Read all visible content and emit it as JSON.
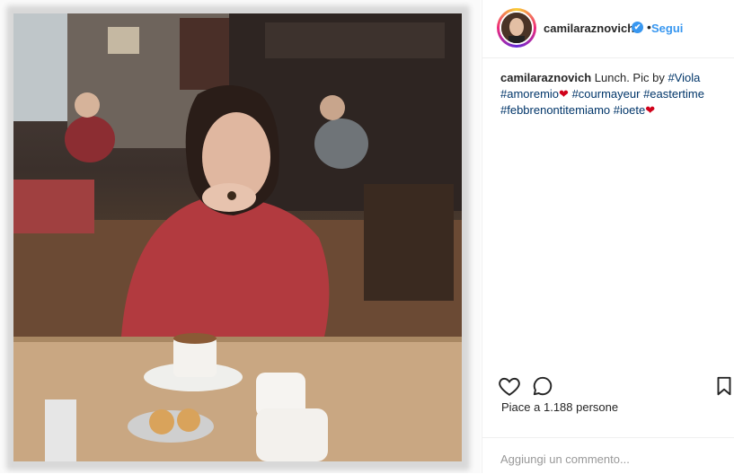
{
  "post": {
    "username": "camilaraznovich",
    "verified_mark": "✔",
    "dot": "•",
    "follow_label": "Segui",
    "caption": {
      "username": "camilaraznovich",
      "text": "Lunch. Pic by",
      "mention": "#Viola",
      "tag_amoremio": "#amoremio",
      "heart": "❤",
      "tag_courmayeur": "#courmayeur",
      "tag_eastertime": "#eastertime",
      "tag_febbrenontitemiamo": "#febbrenontitemiamo",
      "tag_ioete": "#ioete",
      "heart2": "❤"
    },
    "likes_text": "Piace a 1.188 persone",
    "comment_placeholder": "Aggiungi un commento..."
  },
  "icons": {
    "like": "heart-outline-icon",
    "comment": "speech-bubble-icon",
    "save": "bookmark-icon",
    "verified": "verified-badge-icon"
  },
  "colors": {
    "link": "#3897f0",
    "hashtag": "#003569",
    "heart": "#d0021b",
    "text": "#262626"
  }
}
